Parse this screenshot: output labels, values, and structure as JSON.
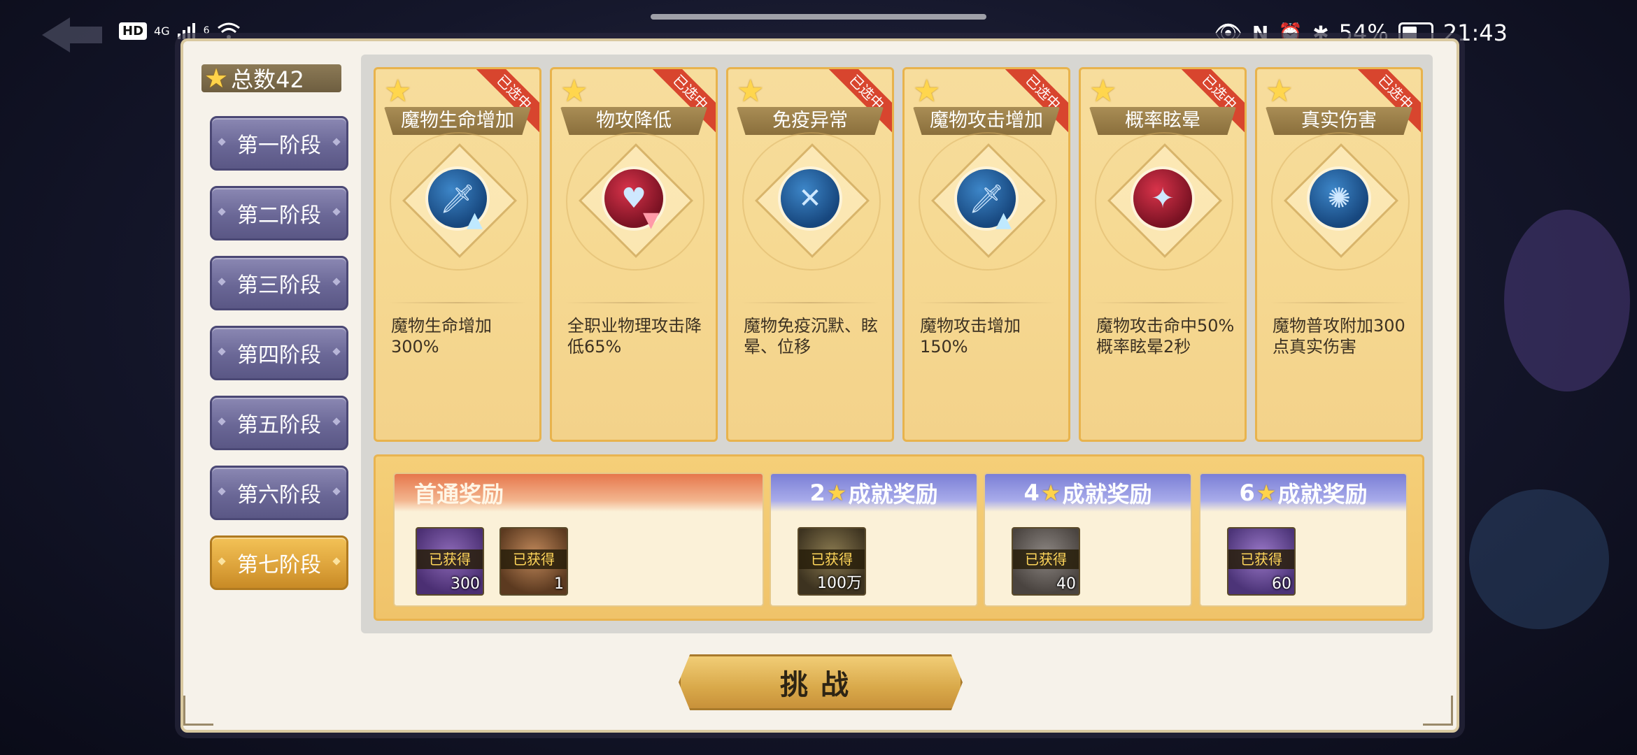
{
  "status_bar": {
    "hd": "HD",
    "network": "4G",
    "wifi_level": "6",
    "battery": "54%",
    "time": "21:43"
  },
  "panel": {
    "total_label": "总数42",
    "stages": [
      {
        "label": "第一阶段",
        "active": false
      },
      {
        "label": "第二阶段",
        "active": false
      },
      {
        "label": "第三阶段",
        "active": false
      },
      {
        "label": "第四阶段",
        "active": false
      },
      {
        "label": "第五阶段",
        "active": false
      },
      {
        "label": "第六阶段",
        "active": false
      },
      {
        "label": "第七阶段",
        "active": true
      }
    ],
    "cards": [
      {
        "title": "魔物生命增加",
        "ribbon": "已选中",
        "icon": "sword-up-icon",
        "desc": "魔物生命增加300%"
      },
      {
        "title": "物攻降低",
        "ribbon": "已选中",
        "icon": "heart-shield-down-icon",
        "desc": "全职业物理攻击降低65%"
      },
      {
        "title": "免疫异常",
        "ribbon": "已选中",
        "icon": "dna-immune-icon",
        "desc": "魔物免疫沉默、眩晕、位移"
      },
      {
        "title": "魔物攻击增加",
        "ribbon": "已选中",
        "icon": "sword-up-icon",
        "desc": "魔物攻击增加150%"
      },
      {
        "title": "概率眩晕",
        "ribbon": "已选中",
        "icon": "stun-stars-icon",
        "desc": "魔物攻击命中50%概率眩晕2秒"
      },
      {
        "title": "真实伤害",
        "ribbon": "已选中",
        "icon": "true-damage-burst-icon",
        "desc": "魔物普攻附加300点真实伤害"
      }
    ],
    "rewards": {
      "first_clear": {
        "title": "首通奖励",
        "items": [
          {
            "obtained": "已获得",
            "qty": "300",
            "icon": "purple-gem-icon"
          },
          {
            "obtained": "已获得",
            "qty": "1",
            "icon": "chest-icon"
          }
        ]
      },
      "achievements": [
        {
          "stars": "2",
          "title": "成就奖励",
          "item": {
            "obtained": "已获得",
            "qty": "100万",
            "icon": "gold-coin-icon"
          }
        },
        {
          "stars": "4",
          "title": "成就奖励",
          "item": {
            "obtained": "已获得",
            "qty": "40",
            "icon": "ore-icon"
          }
        },
        {
          "stars": "6",
          "title": "成就奖励",
          "item": {
            "obtained": "已获得",
            "qty": "60",
            "icon": "purple-crystal-icon"
          }
        }
      ]
    },
    "challenge_label": "挑战"
  }
}
